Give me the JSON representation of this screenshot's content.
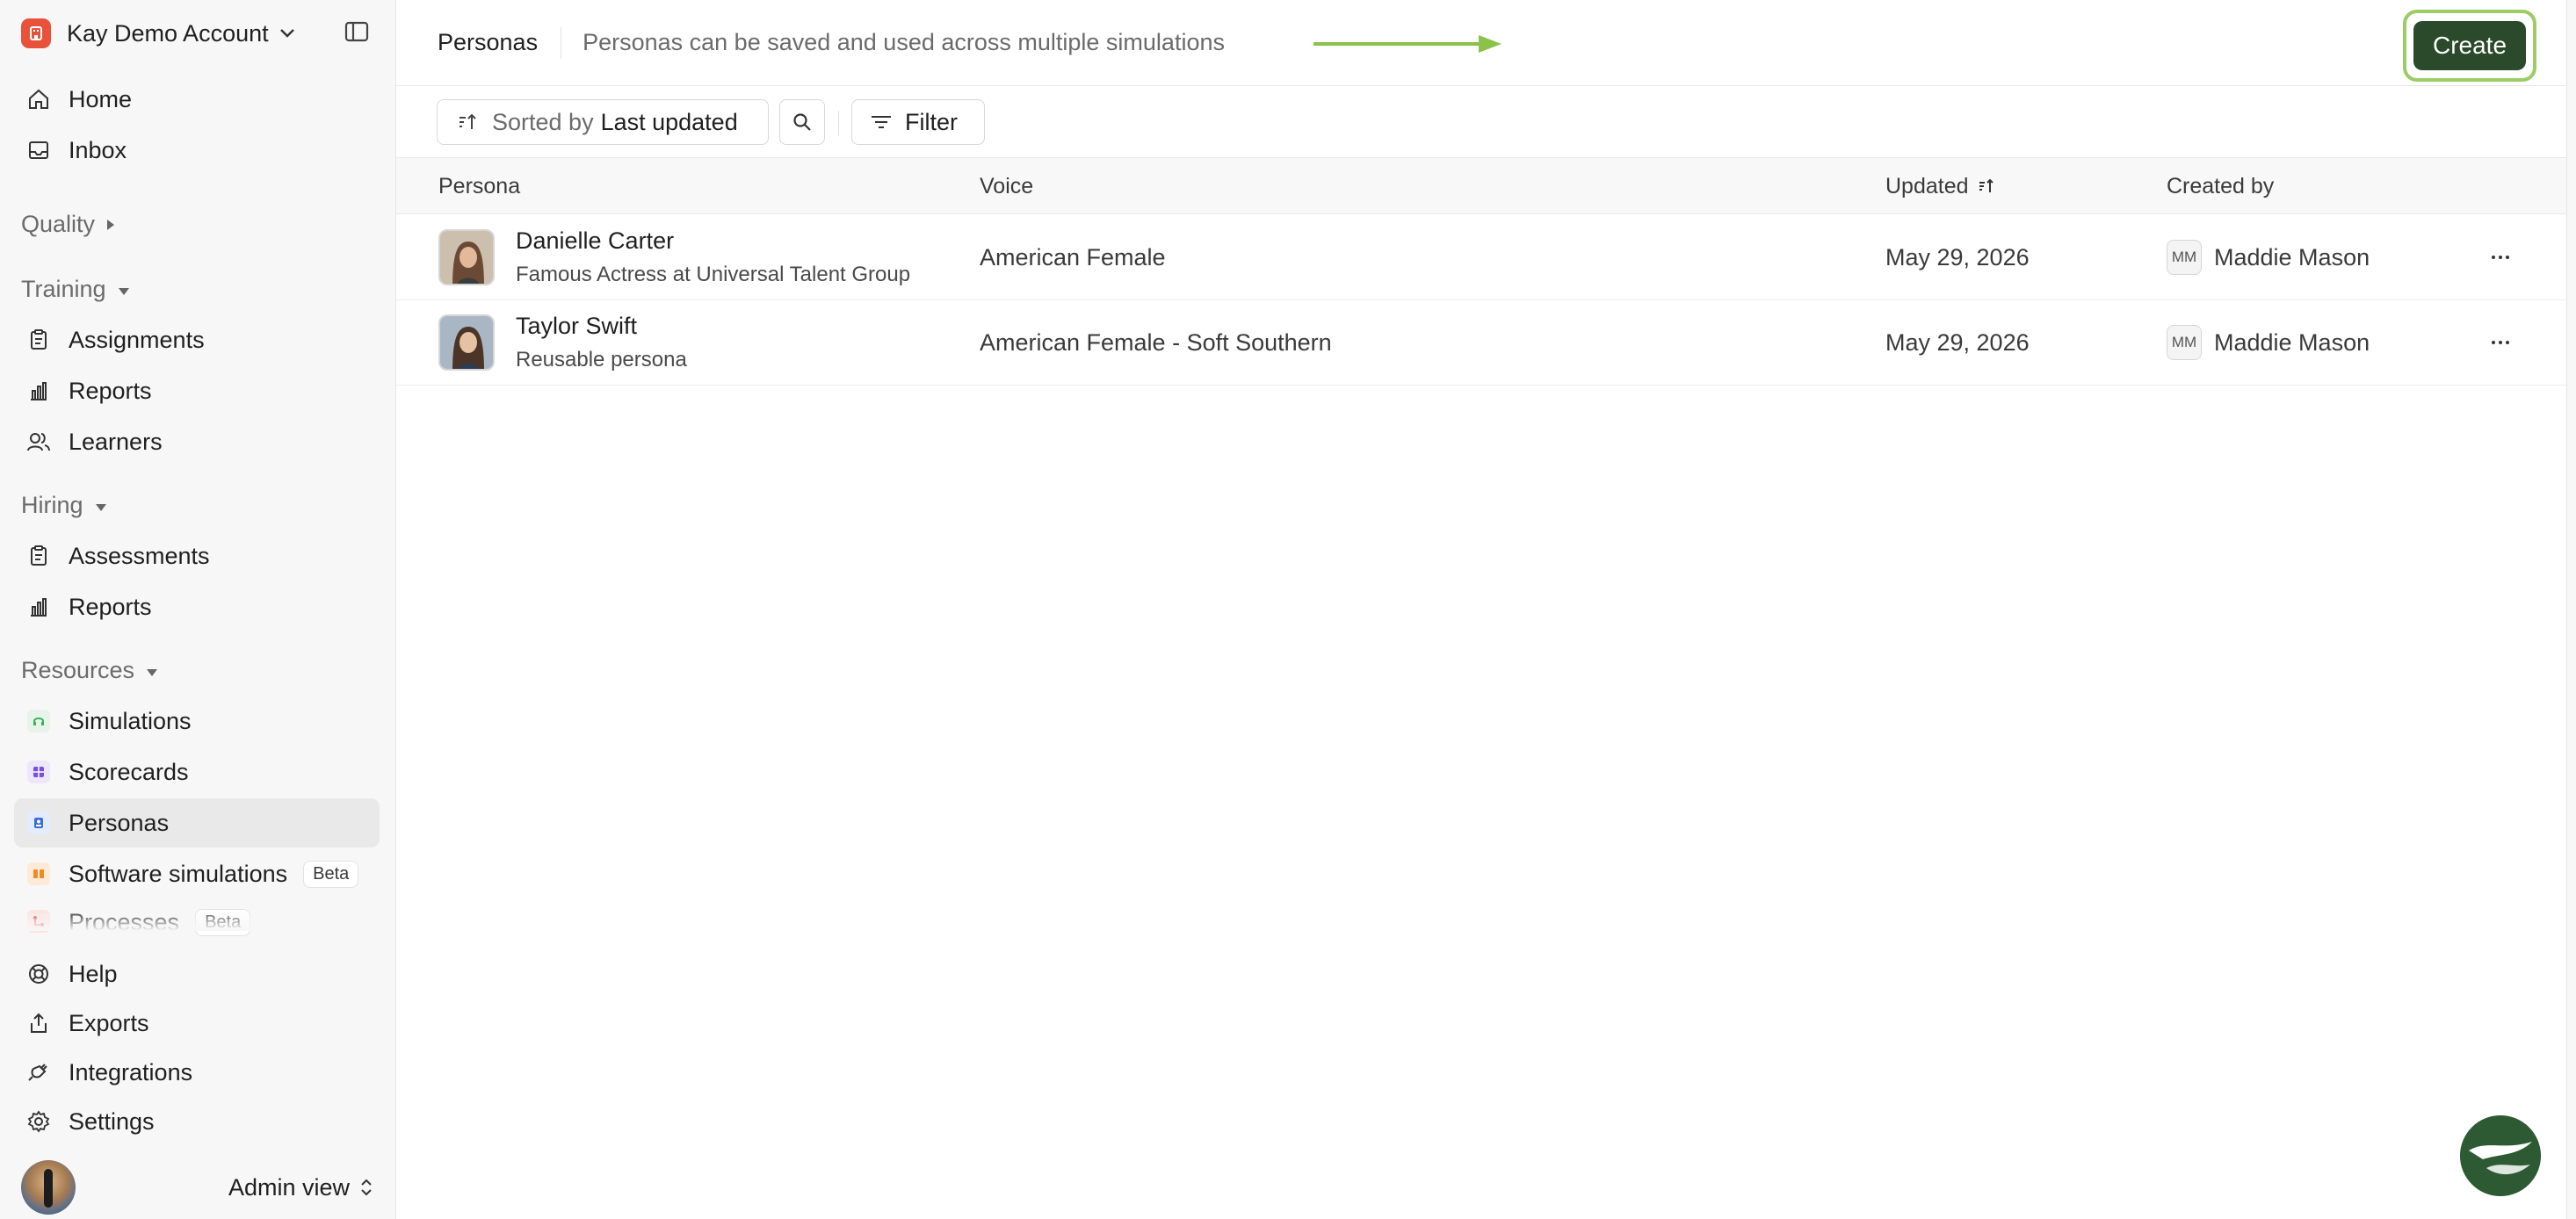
{
  "account": {
    "name": "Kay Demo Account",
    "logo_color": "#e8523a"
  },
  "nav_top": [
    {
      "label": "Home",
      "icon": "home-icon"
    },
    {
      "label": "Inbox",
      "icon": "inbox-icon"
    }
  ],
  "sections": {
    "quality": "Quality",
    "training": "Training",
    "hiring": "Hiring",
    "resources": "Resources"
  },
  "training_items": [
    {
      "label": "Assignments",
      "icon": "clipboard-icon"
    },
    {
      "label": "Reports",
      "icon": "bar-chart-icon"
    },
    {
      "label": "Learners",
      "icon": "users-icon"
    }
  ],
  "hiring_items": [
    {
      "label": "Assessments",
      "icon": "clipboard-icon"
    },
    {
      "label": "Reports",
      "icon": "bar-chart-icon"
    }
  ],
  "resources_items": [
    {
      "label": "Simulations",
      "icon": "headset-icon",
      "color": "#3fae5a"
    },
    {
      "label": "Scorecards",
      "icon": "grid-icon",
      "color": "#7b4fe0"
    },
    {
      "label": "Personas",
      "icon": "persona-icon",
      "color": "#3b6fd6",
      "active": true
    },
    {
      "label": "Software simulations",
      "icon": "software-icon",
      "color": "#f08a24",
      "badge": "Beta"
    },
    {
      "label": "Processes",
      "icon": "process-icon",
      "color": "#e0483a",
      "badge": "Beta"
    }
  ],
  "nav_bottom": [
    {
      "label": "Help",
      "icon": "lifebuoy-icon"
    },
    {
      "label": "Exports",
      "icon": "export-icon"
    },
    {
      "label": "Integrations",
      "icon": "plug-icon"
    },
    {
      "label": "Settings",
      "icon": "gear-icon"
    }
  ],
  "user": {
    "view_label": "Admin view"
  },
  "header": {
    "title": "Personas",
    "subtitle": "Personas can be saved and used across multiple simulations",
    "create_label": "Create"
  },
  "toolbar": {
    "sort_prefix": "Sorted by",
    "sort_value": "Last updated",
    "filter_label": "Filter"
  },
  "table": {
    "columns": [
      "Persona",
      "Voice",
      "Updated",
      "Created by"
    ],
    "rows": [
      {
        "name": "Danielle Carter",
        "description": "Famous Actress at Universal Talent Group",
        "voice": "American Female",
        "updated": "May 29, 2026",
        "creator_initials": "MM",
        "creator": "Maddie Mason"
      },
      {
        "name": "Taylor Swift",
        "description": "Reusable persona",
        "voice": "American Female - Soft Southern",
        "updated": "May 29, 2026",
        "creator_initials": "MM",
        "creator": "Maddie Mason"
      }
    ]
  },
  "colors": {
    "accent_green": "#2b4a2b",
    "highlight": "#9ccc65"
  }
}
